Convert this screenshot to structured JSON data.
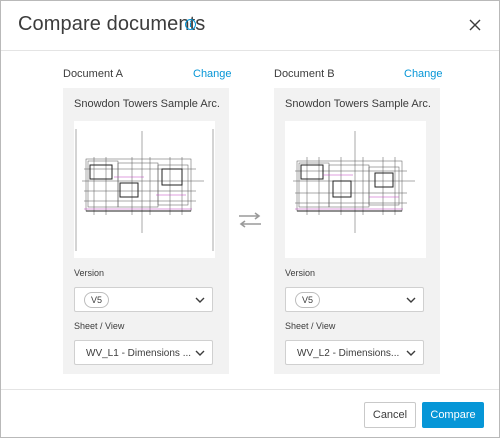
{
  "dialog": {
    "title": "Compare documents",
    "info_icon": "info-icon",
    "close_icon": "close-icon"
  },
  "documents": [
    {
      "label": "Document A",
      "change_label": "Change",
      "name": "Snowdon Towers Sample Arc...",
      "version_label": "Version",
      "version_value": "V5",
      "sheet_label": "Sheet / View",
      "sheet_value": "WV_L1 - Dimensions ..."
    },
    {
      "label": "Document B",
      "change_label": "Change",
      "name": "Snowdon Towers Sample Arc...",
      "version_label": "Version",
      "version_value": "V5",
      "sheet_label": "Sheet / View",
      "sheet_value": "WV_L2 - Dimensions..."
    }
  ],
  "swap_icon": "swap-arrows-icon",
  "footer": {
    "cancel_label": "Cancel",
    "compare_label": "Compare"
  },
  "colors": {
    "accent": "#0696d7",
    "panel_bg": "#f2f2f2"
  }
}
